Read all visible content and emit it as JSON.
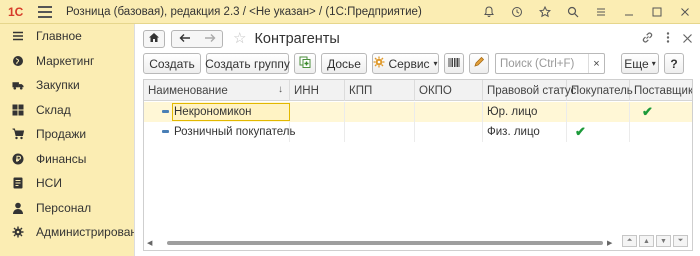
{
  "titlebar": {
    "logo_text": "1С",
    "title": "Розница (базовая), редакция 2.3 / <Не указан> /  (1С:Предприятие)",
    "icons": [
      "bell-icon",
      "history-icon",
      "star-icon",
      "search-icon",
      "menu-icon",
      "minimize-icon",
      "maximize-icon",
      "close-icon"
    ]
  },
  "sidebar": {
    "items": [
      {
        "label": "Главное",
        "icon": "menu-icon"
      },
      {
        "label": "Маркетинг",
        "icon": "globe-icon"
      },
      {
        "label": "Закупки",
        "icon": "truck-icon"
      },
      {
        "label": "Склад",
        "icon": "warehouse-icon"
      },
      {
        "label": "Продажи",
        "icon": "cart-icon"
      },
      {
        "label": "Финансы",
        "icon": "ruble-icon"
      },
      {
        "label": "НСИ",
        "icon": "reference-icon"
      },
      {
        "label": "Персонал",
        "icon": "person-icon"
      },
      {
        "label": "Администрирование",
        "icon": "gear-icon"
      }
    ]
  },
  "header": {
    "title": "Контрагенты"
  },
  "toolbar": {
    "create_label": "Создать",
    "create_group_label": "Создать группу",
    "dossier_label": "Досье",
    "service_label": "Сервис",
    "search_placeholder": "Поиск (Ctrl+F)",
    "more_label": "Еще",
    "help_label": "?"
  },
  "table": {
    "columns": [
      "Наименование",
      "ИНН",
      "КПП",
      "ОКПО",
      "Правовой статус",
      "Покупатель",
      "Поставщик"
    ],
    "rows": [
      {
        "name": "Некрономикон",
        "inn": "",
        "kpp": "",
        "okpo": "",
        "status": "Юр. лицо",
        "buyer": false,
        "supplier": true
      },
      {
        "name": "Розничный покупатель",
        "inn": "",
        "kpp": "",
        "okpo": "",
        "status": "Физ. лицо",
        "buyer": true,
        "supplier": false
      }
    ]
  },
  "colors": {
    "panel": "#fbedb3",
    "selection": "#fff7d6",
    "check": "#1c9a3a"
  }
}
